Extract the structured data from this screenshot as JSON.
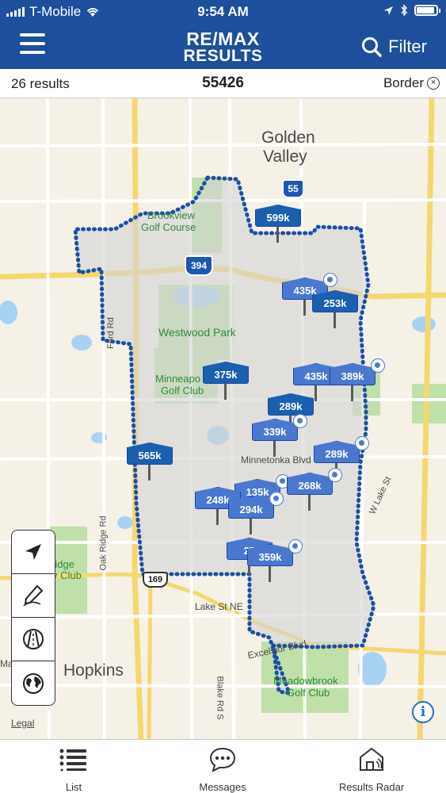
{
  "status": {
    "carrier": "T-Mobile",
    "time": "9:54 AM"
  },
  "header": {
    "logo_line1": "RE/MAX",
    "logo_line2": "RESULTS",
    "filter_label": "Filter"
  },
  "subbar": {
    "results": "26 results",
    "zip": "55426",
    "border_label": "Border",
    "border_close": "×"
  },
  "map": {
    "labels": {
      "golden": "Golden",
      "valley": "Valley",
      "brookview": "Brookview",
      "golfcourse": "Golf Course",
      "westwood": "Westwood Park",
      "minneapo": "Minneapo",
      "golfclub": "Golf Club",
      "minnetonka": "Minnetonka Blvd",
      "ford": "Ford Rd",
      "oakridge": "Oak Ridge Rd",
      "ridge": "Ridge",
      "yclub": "y Club",
      "lakest": "Lake St",
      "lakest_ne": "Lake St NE",
      "wlakest": "W Lake St",
      "excelsior": "Excelsior Blvd",
      "hopkins": "Hopkins",
      "blake": "Blake Rd S",
      "meadowbrook": "Meadowbrook",
      "golfclub2": "Golf Club",
      "hwy394": "394",
      "hwy55": "55",
      "hwy169": "169",
      "ma": "Ma",
      "partial_top": "Brookview"
    },
    "pins": [
      {
        "label": "599k"
      },
      {
        "label": "435k"
      },
      {
        "label": "253k"
      },
      {
        "label": "375k"
      },
      {
        "label": "435k"
      },
      {
        "label": "389k"
      },
      {
        "label": "289k"
      },
      {
        "label": "339k"
      },
      {
        "label": "565k"
      },
      {
        "label": "289k"
      },
      {
        "label": "135k"
      },
      {
        "label": "268k"
      },
      {
        "label": "248k"
      },
      {
        "label": "294k"
      },
      {
        "label": "27"
      },
      {
        "label": "359k"
      }
    ],
    "legal": "Legal",
    "info": "i"
  },
  "tools": [
    "location-arrow-icon",
    "draw-pencil-icon",
    "road-icon",
    "globe-icon"
  ],
  "tabs": {
    "list": "List",
    "messages": "Messages",
    "radar": "Results Radar"
  },
  "colors": {
    "header": "#1d4f9c",
    "pin": "#4a78d1",
    "pin_border": "#1b47a4",
    "boundary": "#1b4fa6"
  }
}
